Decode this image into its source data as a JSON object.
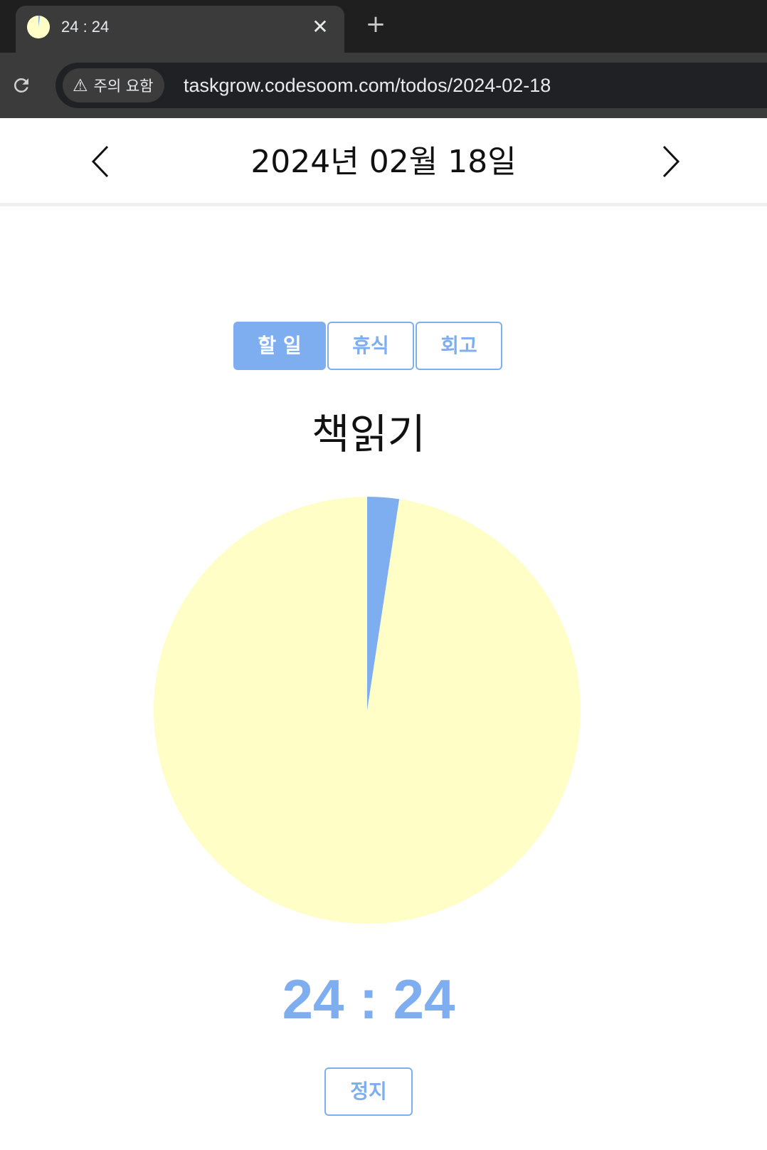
{
  "browser": {
    "tab_title": "24 : 24",
    "tab_close": "✕",
    "new_tab": "+",
    "reload_icon": "reload-icon",
    "security_label": "주의 요함",
    "url": "taskgrow.codesoom.com/todos/2024-02-18"
  },
  "page": {
    "date_title": "2024년 02월 18일",
    "prev_icon": "chevron-left-icon",
    "next_icon": "chevron-right-icon",
    "mode_tabs": [
      {
        "label": "할 일",
        "active": true
      },
      {
        "label": "휴식",
        "active": false
      },
      {
        "label": "회고",
        "active": false
      }
    ],
    "task_title": "책읽기",
    "timer": {
      "display": "24 : 24",
      "elapsed_fraction": 0.024,
      "remaining_color": "#fefec6",
      "elapsed_color": "#7faef0"
    },
    "stop_label": "정지"
  },
  "colors": {
    "accent": "#7faef0",
    "pie_remaining": "#fefec6",
    "chrome_dark": "#1f1f1f",
    "chrome_toolbar": "#3b3b3b"
  }
}
